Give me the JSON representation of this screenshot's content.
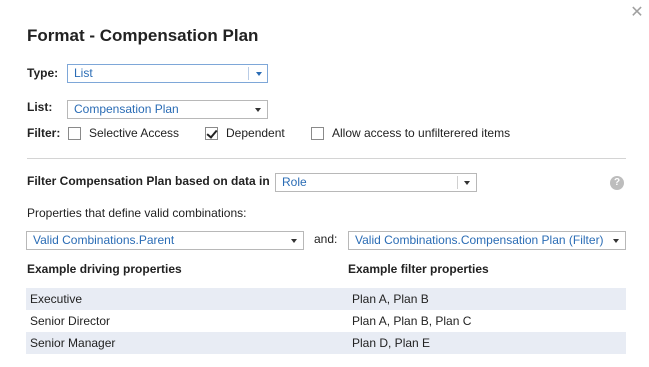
{
  "dialog": {
    "title": "Format - Compensation Plan",
    "close_glyph": "✕"
  },
  "type_field": {
    "label": "Type:",
    "value": "List"
  },
  "list_field": {
    "label": "List:",
    "value": "Compensation Plan"
  },
  "filter_field": {
    "label": "Filter:",
    "options": [
      {
        "label": "Selective Access",
        "checked": false
      },
      {
        "label": "Dependent",
        "checked": true
      },
      {
        "label": "Allow access to unfilterered items",
        "checked": false
      }
    ]
  },
  "filter_based": {
    "label": "Filter Compensation Plan based on data in",
    "value": "Role",
    "help_glyph": "?"
  },
  "properties": {
    "label": "Properties that define valid combinations:",
    "driving_value": "Valid Combinations.Parent",
    "and_label": "and:",
    "filter_value": "Valid Combinations.Compensation Plan (Filter)"
  },
  "examples": {
    "driving_header": "Example driving properties",
    "filter_header": "Example filter properties",
    "rows": [
      {
        "driving": "Executive",
        "filter": "Plan A, Plan B"
      },
      {
        "driving": "Senior Director",
        "filter": "Plan A, Plan B, Plan C"
      },
      {
        "driving": "Senior Manager",
        "filter": "Plan D, Plan E"
      }
    ]
  },
  "colors": {
    "link_blue": "#2a6cb5",
    "row_shade": "#e8ecf4",
    "divider": "#d4d4d4"
  }
}
